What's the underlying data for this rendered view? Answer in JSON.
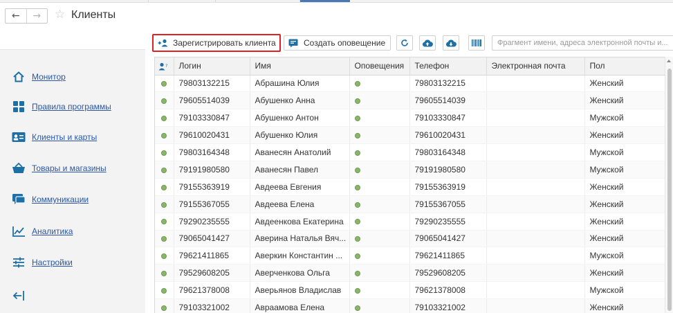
{
  "window": {
    "title": "Клиенты"
  },
  "sidebar": {
    "items": [
      {
        "label": "Монитор",
        "icon": "home-icon"
      },
      {
        "label": "Правила программы",
        "icon": "grid-icon"
      },
      {
        "label": "Клиенты и карты",
        "icon": "id-card-icon"
      },
      {
        "label": "Товары и магазины",
        "icon": "basket-icon"
      },
      {
        "label": "Коммуникации",
        "icon": "chat-icon"
      },
      {
        "label": "Аналитика",
        "icon": "line-chart-icon"
      },
      {
        "label": "Настройки",
        "icon": "sliders-icon"
      }
    ],
    "collapse_icon": "collapse-left-icon"
  },
  "toolbar": {
    "register_label": "Зарегистрировать клиента",
    "notify_label": "Создать оповещение",
    "search_placeholder": "Фрагмент имени, адреса электронной почты и..."
  },
  "table": {
    "columns": [
      "",
      "Логин",
      "Имя",
      "Оповещения",
      "Телефон",
      "Электронная почта",
      "Пол"
    ],
    "rows": [
      {
        "login": "79803132215",
        "name": "Абрашина Юлия",
        "phone": "79803132215",
        "email": "",
        "gender": "Женский"
      },
      {
        "login": "79605514039",
        "name": "Абушенко Анна",
        "phone": "79605514039",
        "email": "",
        "gender": "Женский"
      },
      {
        "login": "79103330847",
        "name": "Абушенко Антон",
        "phone": "79103330847",
        "email": "",
        "gender": "Мужской"
      },
      {
        "login": "79610020431",
        "name": "Абушенко Юлия",
        "phone": "79610020431",
        "email": "",
        "gender": "Женский"
      },
      {
        "login": "79803164348",
        "name": "Аванесян Анатолий",
        "phone": "79803164348",
        "email": "",
        "gender": "Мужской"
      },
      {
        "login": "79191980580",
        "name": "Аванесян Павел",
        "phone": "79191980580",
        "email": "",
        "gender": "Мужской"
      },
      {
        "login": "79155363919",
        "name": "Авдеева Евгения",
        "phone": "79155363919",
        "email": "",
        "gender": "Женский"
      },
      {
        "login": "79155367055",
        "name": "Авдеева Елена",
        "phone": "79155367055",
        "email": "",
        "gender": "Женский"
      },
      {
        "login": "79290235555",
        "name": "Авдеенкова Екатерина",
        "phone": "79290235555",
        "email": "",
        "gender": "Женский"
      },
      {
        "login": "79065041427",
        "name": "Аверина Наталья Вяч...",
        "phone": "79065041427",
        "email": "",
        "gender": "Женский"
      },
      {
        "login": "79621411865",
        "name": "Аверкин Константин ...",
        "phone": "79621411865",
        "email": "",
        "gender": "Мужской"
      },
      {
        "login": "79529608205",
        "name": "Аверченкова Ольга",
        "phone": "79529608205",
        "email": "",
        "gender": "Женский"
      },
      {
        "login": "79621378008",
        "name": "Аверьянов Владислав",
        "phone": "79621378008",
        "email": "",
        "gender": "Мужской"
      },
      {
        "login": "79103321002",
        "name": "Авраамова Елена",
        "phone": "79103321002",
        "email": "",
        "gender": "Женский"
      }
    ]
  },
  "colors": {
    "link": "#2a56a5",
    "accent": "#1d6fa5",
    "status_dot": "#8ab66a",
    "highlight_border": "#e02020"
  }
}
